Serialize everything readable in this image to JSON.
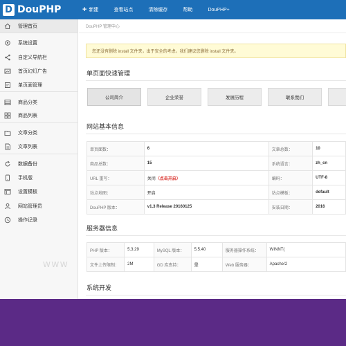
{
  "brand": {
    "name": "DouPHP",
    "mark": "D"
  },
  "topnav": {
    "new": "新建",
    "view_site": "查看站点",
    "clear_cache": "清除缓存",
    "help": "帮助",
    "douphp_plus": "DouPHP+"
  },
  "sidebar": {
    "items": [
      {
        "label": "管理首页",
        "icon": "home-icon"
      },
      {
        "label": "系统设置",
        "icon": "gear-icon"
      },
      {
        "label": "自定义导航栏",
        "icon": "share-icon"
      },
      {
        "label": "首页幻灯广告",
        "icon": "slideshow-icon"
      },
      {
        "label": "单页面管理",
        "icon": "page-icon"
      },
      {
        "label": "商品分类",
        "icon": "category-icon"
      },
      {
        "label": "商品列表",
        "icon": "grid-icon"
      },
      {
        "label": "文章分类",
        "icon": "folder-icon"
      },
      {
        "label": "文章列表",
        "icon": "document-icon"
      },
      {
        "label": "数据备份",
        "icon": "refresh-icon"
      },
      {
        "label": "手机版",
        "icon": "mobile-icon"
      },
      {
        "label": "设置模板",
        "icon": "template-icon"
      },
      {
        "label": "网站管理员",
        "icon": "user-icon"
      },
      {
        "label": "操作记录",
        "icon": "clock-icon"
      }
    ]
  },
  "breadcrumb": "DouPHP 管理中心",
  "notice": "您还没有删除 install 文件夹，出于安全的考虑，我们建议您删除 install 文件夹。",
  "quick": {
    "title": "单页面快速管理",
    "buttons": [
      "公司简介",
      "企业荣誉",
      "发展历程",
      "联系我们"
    ]
  },
  "site_info": {
    "title": "网站基本信息",
    "rows": [
      {
        "l1": "单页面数：",
        "v1": "6",
        "l2": "文章总数：",
        "v2": "10"
      },
      {
        "l1": "商品总数：",
        "v1": "15",
        "l2": "系统语言：",
        "v2": "zh_cn"
      },
      {
        "l1": "URL 重写：",
        "v1": "关闭",
        "v1_extra": "（点击开启）",
        "l2": "编码：",
        "v2": "UTF-8"
      },
      {
        "l1": "站点地图：",
        "v1": "开启",
        "l2": "站点模板：",
        "v2": "default"
      },
      {
        "l1": "DouPHP 版本：",
        "v1": "v1.3 Release 20160125",
        "l2": "安装日期：",
        "v2": "2016"
      }
    ]
  },
  "server_info": {
    "title": "服务器信息",
    "rows": [
      {
        "l1": "PHP 版本：",
        "v1": "5.3.29",
        "l2": "MySQL 版本：",
        "v2": "5.5.40",
        "l3": "服务器操作系统：",
        "v3": "WINNT("
      },
      {
        "l1": "文件上传限制：",
        "v1": "2M",
        "l2": "GD 库支持：",
        "v2": "是",
        "l3": "Web 服务器：",
        "v3": "Apache/2"
      }
    ]
  },
  "dev": {
    "title": "系统开发"
  },
  "watermark": "WWW",
  "colors": {
    "topbar": "#1d6fb8",
    "band": "#5b2a86",
    "notice_bg": "#fffbd6",
    "link_red": "#d9302a"
  }
}
